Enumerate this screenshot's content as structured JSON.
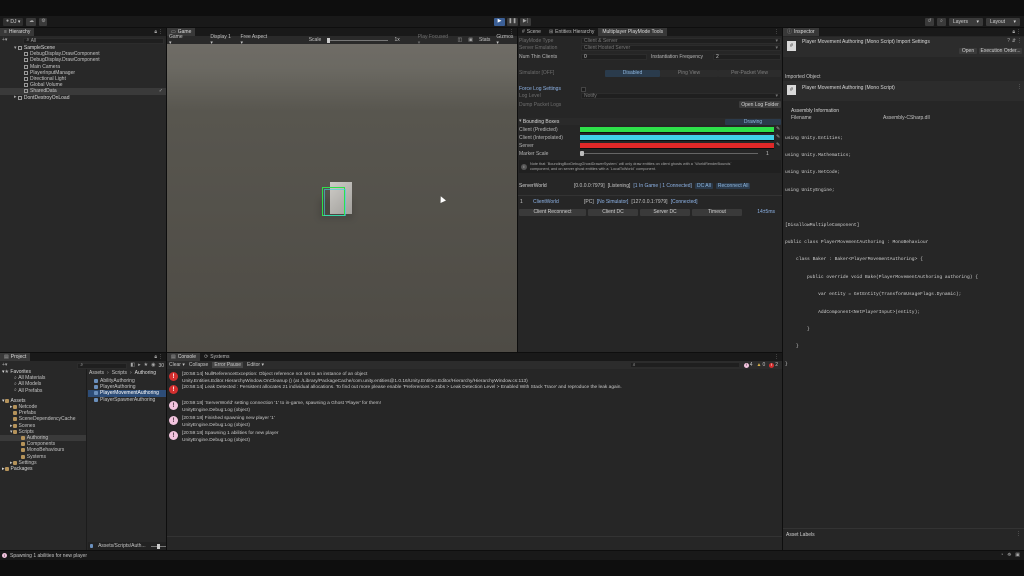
{
  "toolbar": {
    "account": "DJ",
    "layers": "Layers",
    "layout": "Layout"
  },
  "hierarchy": {
    "tab": "Hierarchy",
    "search_value": "All",
    "items": [
      {
        "label": "SampleScene"
      },
      {
        "label": "DebugDisplay.DrawComponent"
      },
      {
        "label": "DebugDisplay.DrawComponent"
      },
      {
        "label": "Main Camera"
      },
      {
        "label": "PlayerInputManager"
      },
      {
        "label": "Directional Light"
      },
      {
        "label": "Global Volume"
      },
      {
        "label": "SharedData"
      },
      {
        "label": "DontDestroyOnLoad"
      }
    ]
  },
  "game": {
    "tab": "Game",
    "mode": "Game",
    "display": "Display 1",
    "aspect": "Free Aspect",
    "scale_label": "Scale",
    "scale_value": "1x",
    "play_focused": "Play Focused",
    "stats": "Stats",
    "gizmos": "Gizmos"
  },
  "playmode": {
    "tabs": [
      "Scene",
      "Entities Hierarchy",
      "Multiplayer PlayMode Tools"
    ],
    "playmode_type_label": "PlayMode Type",
    "playmode_type_value": "Client & Server",
    "server_emulation_label": "Server Emulation",
    "server_emulation_value": "Client Hosted Server",
    "num_thin_clients_label": "Num Thin Clients",
    "num_thin_clients_value": "0",
    "instantiation_frequency_label": "Instantiation Frequency",
    "instantiation_frequency_value": "2",
    "simulator_label": "Simulator [OFF]",
    "simulator_disabled": "Disabled",
    "simulator_ping_view": "Ping View",
    "simulator_per_packet": "Per-Packet View",
    "force_log_settings": "Force Log Settings",
    "log_level_label": "Log Level",
    "log_level_value": "Notify",
    "dump_packet_logs": "Dump Packet Logs",
    "open_log_folder": "Open Log Folder",
    "bounding_boxes": "Bounding Boxes",
    "drawing": "Drawing",
    "client_predicted": "Client (Predicted)",
    "client_interpolated": "Client (Interpolated)",
    "server": "Server",
    "marker_scale": "Marker Scale",
    "marker_scale_value": "1",
    "note_line1": "Note that `BoundingBoxDebugGhostDrawerSystem` will only draw entities on client ghosts with a `WorldRenderBounds`",
    "note_line2": "component, and on server ghost entities with a `LocalToWorld` component.",
    "server_world_label": "ServerWorld",
    "server_world_address": "[0.0.0.0:7979]",
    "server_world_status": "[Listening]",
    "server_world_ingame": "[1 In Game | 1 Connected]",
    "dc_all": "DC All",
    "reconnect_all": "Reconnect All",
    "client_index": "1",
    "client_world_label": "ClientWorld",
    "client_world_pc": "[PC]",
    "client_world_simulator": "[No Simulator]",
    "client_world_address": "[127.0.0.1:7979]",
    "client_world_connected": "[Connected]",
    "client_reconnect": "Client Reconnect",
    "client_dc": "Client DC",
    "server_dc": "Server DC",
    "timeout": "Timeout",
    "ping": "14±5ms",
    "colors": {
      "predicted": "#2ee04a",
      "interpolated": "#3fd0e8",
      "server": "#e02828"
    }
  },
  "inspector": {
    "tab": "Inspector",
    "title": "Player Movement Authoring (Mono Script) Import Settings",
    "open": "Open",
    "execution_order": "Execution Order...",
    "imported_object": "Imported Object",
    "object_title": "Player Movement Authoring (Mono Script)",
    "assembly_information": "Assembly Information",
    "filename_label": "Filename",
    "filename_value": "Assembly-CSharp.dll",
    "code_lines": [
      "using Unity.Entities;",
      "using Unity.Mathematics;",
      "using Unity.NetCode;",
      "using UnityEngine;",
      "",
      "[DisallowMultipleComponent]",
      "public class PlayerMovementAuthoring : MonoBehaviour",
      "    class Baker : Baker<PlayerMovementAuthoring> {",
      "        public override void Bake(PlayerMovementAuthoring authoring) {",
      "            var entity = GetEntity(TransformUsageFlags.Dynamic);",
      "            AddComponent<NetPlayerInput>(entity);",
      "        }",
      "    }",
      "}"
    ],
    "asset_labels": "Asset Labels"
  },
  "project": {
    "tab": "Project",
    "badge_count": "30",
    "favorites": "Favorites",
    "fav_items": [
      "All Materials",
      "All Models",
      "All Prefabs"
    ],
    "assets": "Assets",
    "folders": [
      "Netcode",
      "Prefabs",
      "SceneDependencyCache",
      "Scenes",
      "Scripts",
      "Authoring",
      "Components",
      "MonoBehaviours",
      "Systems",
      "Settings"
    ],
    "packages": "Packages",
    "breadcrumb": [
      "Assets",
      "Scripts",
      "Authoring"
    ],
    "files": [
      "AbilityAuthoring",
      "PlayerAuthoring",
      "PlayerMovementAuthoring",
      "PlayerSpawnerAuthoring"
    ],
    "path": "Assets/Scripts/Auth..."
  },
  "console": {
    "tabs": [
      "Console",
      "Systems"
    ],
    "clear": "Clear",
    "collapse": "Collapse",
    "error_pause": "Error Pause",
    "editor": "Editor",
    "info_count": "4",
    "warn_count": "0",
    "error_count": "2",
    "logs": [
      {
        "type": "error",
        "line1": "[20:58:14] NullReferenceException: Object reference not set to an instance of an object",
        "line2": "Unity.Entities.Editor.HierarchyWindow.OnCleanup () (at ./Library/PackageCache/com.unity.entities@1.0.16/Unity.Entities.Editor/Hierarchy/HierarchyWindow.cs:113)"
      },
      {
        "type": "error",
        "line1": "[20:58:14] Leak Detected : Persistent allocates 21 individual allocations. To find out more please enable 'Preferences > Jobs > Leak Detection Level > Enabled With Stack Trace' and reproduce the leak again.",
        "line2": ""
      },
      {
        "type": "info",
        "line1": "[20:59:18] 'ServerWorld' setting connection '1' to in-game, spawning a Ghost 'Player' for them!",
        "line2": "UnityEngine.Debug:Log (object)"
      },
      {
        "type": "info",
        "line1": "[20:59:18] Finished spawning new player '1'",
        "line2": "UnityEngine.Debug:Log (object)"
      },
      {
        "type": "info",
        "line1": "[20:59:18] Spawning 1 abilities for new player",
        "line2": "UnityEngine.Debug:Log (object)"
      }
    ]
  },
  "statusbar": {
    "message": "Spawning 1 abilities for new player"
  }
}
